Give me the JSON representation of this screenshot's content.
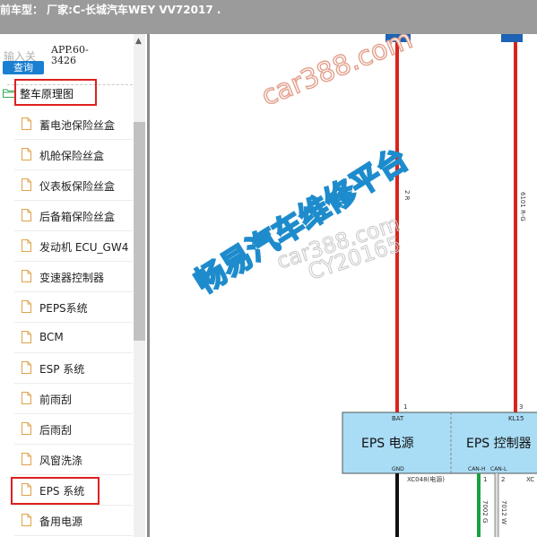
{
  "header": {
    "title": "前车型：  厂家:C-长城汽车WEY VV72017    ."
  },
  "sidebar": {
    "search_label": "输入关",
    "query_button": "查询",
    "code_value": "APP.60-3426",
    "root_label": "整车原理图",
    "items": [
      {
        "label": "蓄电池保险丝盒"
      },
      {
        "label": "机舱保险丝盒"
      },
      {
        "label": "仪表板保险丝盒"
      },
      {
        "label": "后备箱保险丝盒"
      },
      {
        "label": "发动机 ECU_GW4"
      },
      {
        "label": "变速器控制器"
      },
      {
        "label": "PEPS系统"
      },
      {
        "label": "BCM"
      },
      {
        "label": "ESP 系统"
      },
      {
        "label": "前雨刮"
      },
      {
        "label": "后雨刮"
      },
      {
        "label": "风窗洗涤"
      },
      {
        "label": "EPS 系统"
      },
      {
        "label": "备用电源"
      }
    ],
    "highlighted_item": "EPS 系统"
  },
  "diagram": {
    "wire_left_label": "2 R",
    "wire_right_label": "6101 R-G",
    "pin_left": "1",
    "pin_right": "3",
    "module_pin_bat": "BAT",
    "module_pin_kl15": "KL15",
    "module_power_label": "EPS 电源",
    "module_control_label": "EPS 控制器",
    "module_pin_gnd": "GND",
    "module_pin_canh": "CAN-H",
    "module_pin_canl": "CAN-L",
    "connector_label": "XC048(电源)",
    "pin_canh_num": "1",
    "pin_canl_num": "2",
    "connector_label_right": "XC",
    "wire_bottom_1": "7002 G",
    "wire_bottom_2": "7012 W",
    "watermark_1": "car388.com",
    "watermark_2": "畅易汽车维修平台",
    "watermark_3": "car388.com",
    "watermark_4": "CY20165",
    "colors": {
      "wire_red": "#d9241c",
      "module_fill": "#a9dcf5",
      "wire_green": "#19a040",
      "watermark_blue": "#1e8ccc"
    }
  }
}
